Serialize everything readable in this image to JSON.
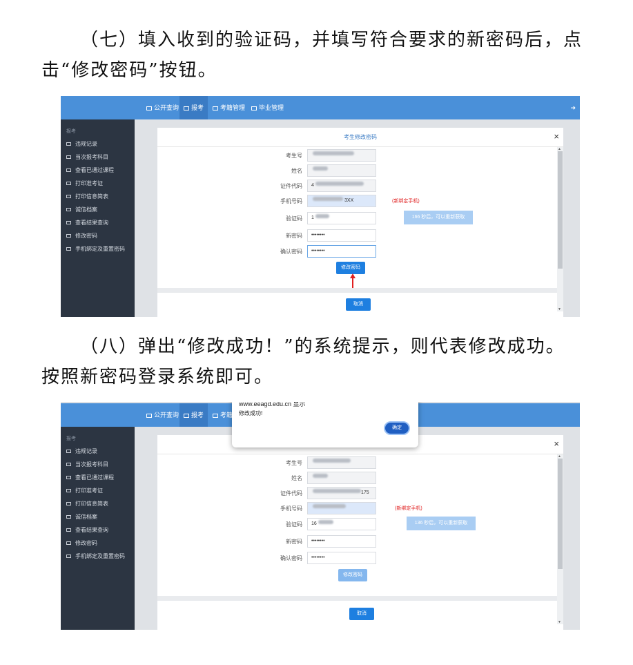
{
  "paragraph1": {
    "line1": "（七）填入收到的验证码，并填写符合要求的新密码后，点",
    "line2": "击“修改密码”按钮。"
  },
  "paragraph2": {
    "line1": "（八）弹出“修改成功！”的系统提示，则代表修改成功。",
    "line2": "按照新密码登录系统即可。"
  },
  "nav": {
    "items": [
      "公开查询",
      "报考",
      "考籍管理",
      "毕业管理"
    ]
  },
  "sidebar": {
    "title": "报考",
    "items": [
      "违规记录",
      "当次报考科目",
      "查看已通过课程",
      "打印准考证",
      "打印信息简表",
      "诚信档案",
      "查看结果查询",
      "修改密码",
      "手机绑定及重置密码"
    ]
  },
  "modal": {
    "title": "考生修改密码",
    "close": "×",
    "labels": {
      "exam_no": "考生号",
      "name": "姓名",
      "id_code": "证件代码",
      "phone": "手机号码",
      "code": "验证码",
      "new_password": "新密码",
      "confirm_password": "确认密码"
    },
    "unbind_note": "(新绑定手机)",
    "submit_label": "修改密码",
    "cancel_label": "取消"
  },
  "screenshot1": {
    "id_prefix": "4",
    "phone_suffix": "3XX",
    "code_prefix": "1",
    "new_password": "••••••••",
    "confirm_password": "••••••••",
    "countdown": "166 秒后，可以重新获取"
  },
  "screenshot2": {
    "code_prefix": "16",
    "id_suffix": "175",
    "new_password": "••••••••",
    "confirm_password": "••••••••",
    "countdown": "136 秒后，可以重新获取",
    "alert": {
      "domain": "www.eeagd.edu.cn 显示",
      "message": "修改成功!",
      "ok_label": "确定"
    }
  },
  "colors": {
    "nav_blue": "#4a90d9",
    "sidebar_dark": "#2c3542",
    "button_blue": "#1e7fe0",
    "warning_red": "#e02020"
  }
}
